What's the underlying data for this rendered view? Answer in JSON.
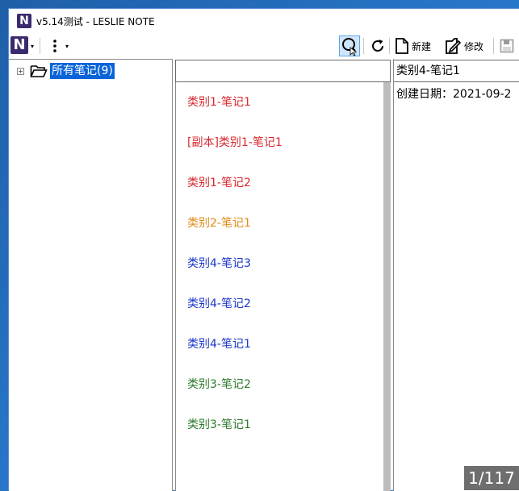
{
  "window": {
    "title": "v5.14测试 - LESLIE NOTE"
  },
  "toolbar": {
    "new_label": "新建",
    "edit_label": "修改"
  },
  "tree": {
    "root_label": "所有笔记(9)"
  },
  "notes": [
    {
      "title": "类别1-笔记1",
      "color": "#d8282e"
    },
    {
      "title": "[副本]类别1-笔记1",
      "color": "#d8282e"
    },
    {
      "title": "类别1-笔记2",
      "color": "#d8282e"
    },
    {
      "title": "类别2-笔记1",
      "color": "#e08a16"
    },
    {
      "title": "类别4-笔记3",
      "color": "#1a36c8"
    },
    {
      "title": "类别4-笔记2",
      "color": "#1a36c8"
    },
    {
      "title": "类别4-笔记1",
      "color": "#1a36c8"
    },
    {
      "title": "类别3-笔记2",
      "color": "#2c7a2c"
    },
    {
      "title": "类别3-笔记1",
      "color": "#2c7a2c"
    }
  ],
  "detail": {
    "title": "类别4-笔记1",
    "date_label": "创建日期：2021-09-2"
  },
  "pager": {
    "text": "1/117"
  },
  "icons": {
    "app": "leslie-note-logo-icon",
    "menu": "more-vertical-icon",
    "search": "search-icon",
    "refresh": "refresh-icon",
    "new": "new-document-icon",
    "edit": "edit-document-icon",
    "save": "save-icon",
    "folder": "open-folder-icon"
  }
}
